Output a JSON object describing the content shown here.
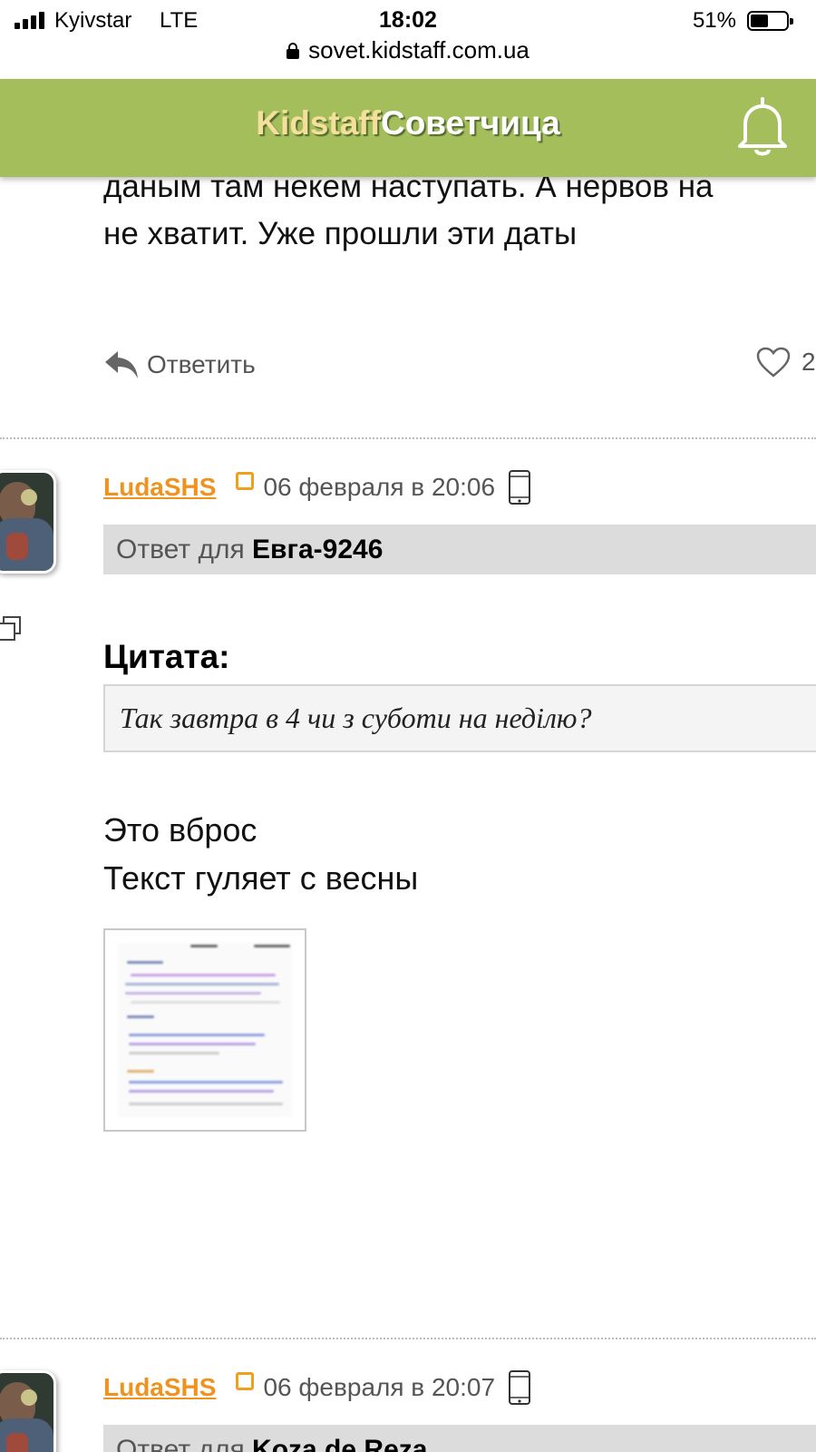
{
  "status_bar": {
    "carrier": "Kyivstar",
    "network": "LTE",
    "time": "18:02",
    "battery": "51%",
    "battery_level": 0.51
  },
  "browser": {
    "url": "sovet.kidstaff.com.ua"
  },
  "header": {
    "logo_part1": "Kidstaff",
    "logo_part2": "Советчица",
    "bell_icon": "bell-icon"
  },
  "previous_post": {
    "text_line1": "даным там некем наступать. А нервов на",
    "text_line2": "не хватит. Уже прошли эти даты",
    "reply_label": "Ответить",
    "like_count": "2"
  },
  "posts": [
    {
      "username": "LudaSHS",
      "date": "06 февраля в 20:06",
      "reply_prefix": "Ответ для",
      "reply_target": "Евга-9246",
      "quote_title": "Цитата:",
      "quote_text": "Так завтра в 4 чи з суботи на неділю?",
      "text_line1": "Это вброс",
      "text_line2": "Текст гуляет с весны"
    },
    {
      "username": "LudaSHS",
      "date": "06 февраля в 20:07",
      "reply_prefix": "Ответ для",
      "reply_target": "Koza de Reza"
    }
  ],
  "colors": {
    "header_bg": "#a4be5c",
    "username": "#f0921e",
    "reply_bar": "#dcdcdc"
  }
}
